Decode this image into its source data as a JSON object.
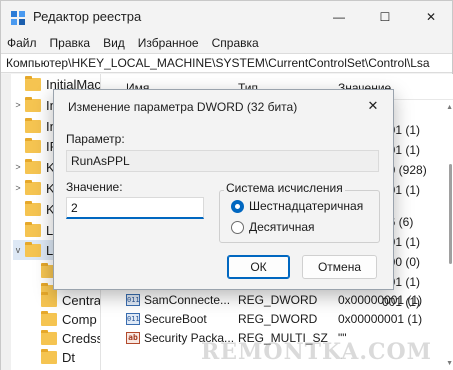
{
  "window": {
    "title": "Редактор реестра",
    "controls": {
      "minimize": "—",
      "maximize": "☐",
      "close": "✕"
    }
  },
  "menu": [
    "Файл",
    "Правка",
    "Вид",
    "Избранное",
    "Справка"
  ],
  "address": "Компьютер\\HKEY_LOCAL_MACHINE\\SYSTEM\\CurrentControlSet\\Control\\Lsa",
  "tree": {
    "items": [
      {
        "label": "InitialMac",
        "chevron": ""
      },
      {
        "label": "Int",
        "chevron": ">"
      },
      {
        "label": "Int",
        "chevron": ""
      },
      {
        "label": "IP",
        "chevron": ""
      },
      {
        "label": "Ke",
        "chevron": ">"
      },
      {
        "label": "Ke",
        "chevron": ">"
      },
      {
        "label": "KL",
        "chevron": ""
      },
      {
        "label": "Le",
        "chevron": ""
      },
      {
        "label": "Lsa",
        "chevron": "v"
      },
      {
        "label": "",
        "chevron": ""
      },
      {
        "label": "",
        "chevron": ""
      },
      {
        "label": "Centra",
        "chevron": ""
      },
      {
        "label": "Comp",
        "chevron": ""
      },
      {
        "label": "Credss",
        "chevron": ""
      },
      {
        "label": "Dt",
        "chevron": ""
      }
    ]
  },
  "list": {
    "columns": {
      "name": "Имя",
      "type": "Тип",
      "value": "Значение"
    },
    "partial_values": [
      "001 (1)",
      "001 (1)",
      "a0 (928)",
      "001 (1)",
      "06 (6)",
      "001 (1)",
      "000 (0)",
      "001 (1)",
      "001 (1)"
    ],
    "rows": [
      {
        "icon": "dword",
        "name": "SamConnecte...",
        "type": "REG_DWORD",
        "value": "0x00000001 (1)"
      },
      {
        "icon": "dword",
        "name": "SecureBoot",
        "type": "REG_DWORD",
        "value": "0x00000001 (1)"
      },
      {
        "icon": "string",
        "name": "Security Packa...",
        "type": "REG_MULTI_SZ",
        "value": "\"\""
      }
    ]
  },
  "dialog": {
    "title": "Изменение параметра DWORD (32 бита)",
    "close_glyph": "✕",
    "param_label": "Параметр:",
    "param_value": "RunAsPPL",
    "value_label": "Значение:",
    "value": "2",
    "base_legend": "Система исчисления",
    "base_options": [
      {
        "label": "Шестнадцатеричная",
        "selected": true
      },
      {
        "label": "Десятичная",
        "selected": false
      }
    ],
    "ok_label": "ОК",
    "cancel_label": "Отмена"
  },
  "watermark": "REMONTKA.COM"
}
